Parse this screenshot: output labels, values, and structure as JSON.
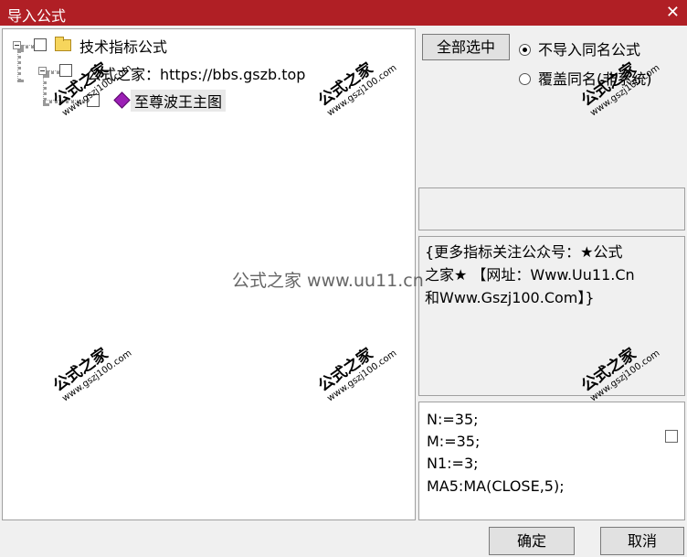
{
  "window": {
    "title": "导入公式",
    "close_glyph": "✕"
  },
  "tree": {
    "root": {
      "label": "技术指标公式"
    },
    "group": {
      "label": "公式之家：https://bbs.gszb.top"
    },
    "item": {
      "label": "至尊波王主图"
    }
  },
  "options": {
    "select_all_label": "全部选中",
    "radio_skip_label": "不导入同名公式",
    "radio_overwrite_label": "覆盖同名(非系统)"
  },
  "description": {
    "line1": "{更多指标关注公众号：★公式",
    "line2": "之家★ 【网址：Www.Uu11.Cn",
    "line3": "和Www.Gszj100.Com】}"
  },
  "code": {
    "lines": [
      "N:=35;",
      "M:=35;",
      "N1:=3;",
      "MA5:MA(CLOSE,5);"
    ]
  },
  "buttons": {
    "ok": "确定",
    "cancel": "取消"
  },
  "watermark": {
    "chinese": "公式之家",
    "url": "www.gszj100.com",
    "center": "公式之家 www.uu11.cn"
  }
}
